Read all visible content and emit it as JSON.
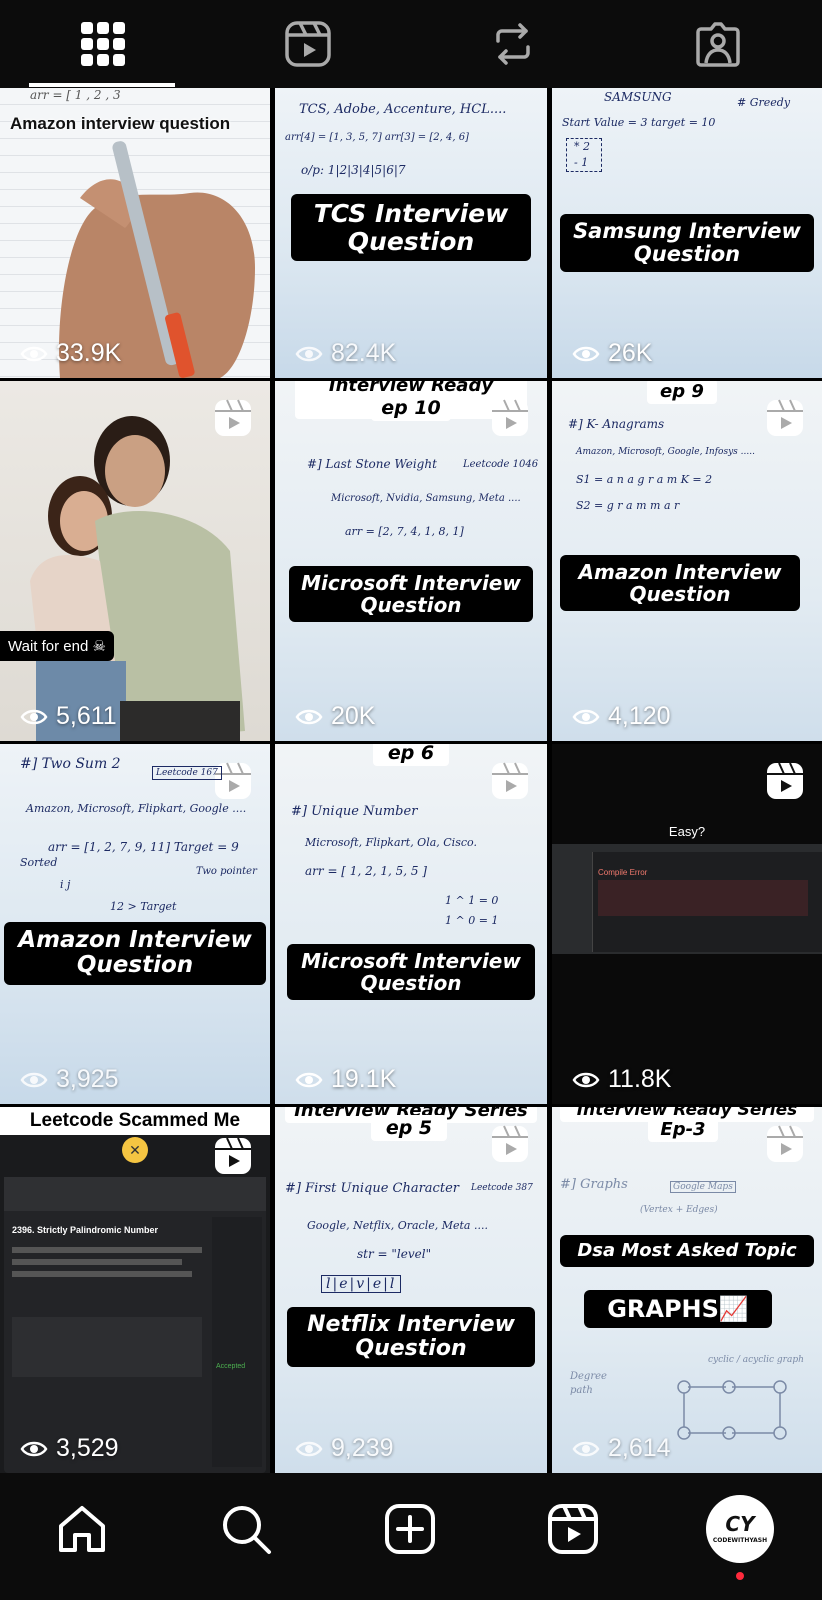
{
  "tabs": [
    {
      "name": "posts-grid",
      "icon": "grid-icon",
      "active": true
    },
    {
      "name": "reels",
      "icon": "reels-icon",
      "active": false
    },
    {
      "name": "reposts",
      "icon": "repost-icon",
      "active": false
    },
    {
      "name": "tagged",
      "icon": "tagged-person-icon",
      "active": false
    }
  ],
  "tiles": [
    {
      "title": "Amazon interview question",
      "views": "33.9K",
      "hw": [
        "arr = [ 1 , 2 , 3"
      ]
    },
    {
      "title": "TCS Interview Question",
      "views": "82.4K",
      "hw": [
        "TCS, Adobe, Accenture, HCL....",
        "arr[4] = [1, 3, 5, 7]   arr[3] = [2, 4, 6]",
        "o/p: 1|2|3|4|5|6|7"
      ]
    },
    {
      "title": "Samsung Interview Question",
      "views": "26K",
      "hw": [
        "SAMSUNG",
        "# Greedy",
        "Start Value = 3    target = 10",
        "* 2",
        "- 1"
      ]
    },
    {
      "title": "Wait for end",
      "views": "5,611",
      "hw": []
    },
    {
      "top": "Interview Ready Series",
      "top2": "ep 10",
      "title": "Microsoft Interview Question",
      "views": "20K",
      "hw": [
        "#] Last Stone Weight",
        "Leetcode 1046",
        "Microsoft, Nvidia, Samsung, Meta ....",
        "arr = [2, 7, 4, 1, 8, 1]"
      ]
    },
    {
      "top2": "ep 9",
      "title": "Amazon Interview Question",
      "views": "4,120",
      "hw": [
        "#] K- Anagrams",
        "Amazon, Microsoft, Google, Infosys .....",
        "S1 = a n a g r a m      K = 2",
        "S2 = g r a m m a r"
      ]
    },
    {
      "title": "Amazon Interview Question",
      "views": "3,925",
      "hw": [
        "#] Two Sum 2",
        "Leetcode 167",
        "Amazon, Microsoft, Flipkart, Google ....",
        "arr = [1, 2, 7, 9, 11]   Target = 9",
        "Sorted",
        "Two pointer",
        "i  j",
        "12 > Target"
      ]
    },
    {
      "top2": "ep 6",
      "title": "Microsoft Interview Question",
      "views": "19.1K",
      "hw": [
        "#] Unique Number",
        "Microsoft, Flipkart, Ola, Cisco.",
        "arr = [ 1, 2, 1, 5, 5 ]",
        "1 ^ 1 = 0",
        "1 ^ 0 = 1"
      ]
    },
    {
      "title": "Easy?",
      "views": "11.8K",
      "hw": [
        "Compile Error"
      ]
    },
    {
      "top": "Leetcode Scammed Me",
      "title": "",
      "views": "3,529",
      "hw": [
        "2396. Strictly Palindromic Number",
        "Accepted"
      ]
    },
    {
      "top": "Interview Ready Series",
      "top2": "ep 5",
      "title": "Netflix Interview Question",
      "views": "9,239",
      "hw": [
        "#] First Unique Character",
        "Leetcode 387",
        "Google, Netflix, Oracle, Meta ....",
        "str = \"level\"",
        "l|e|v|e|l"
      ]
    },
    {
      "top": "Interview Ready Series",
      "top2": "Ep-3",
      "title": "Dsa Most Asked Topic",
      "title2": "GRAPHS📈",
      "views": "2,614",
      "hw": [
        "#] Graphs",
        "Google Maps",
        "(Vertex + Edges)",
        "Degree",
        "path",
        "cyclic / acyclic graph"
      ]
    }
  ],
  "bottom_nav": [
    {
      "name": "home",
      "icon": "home-icon"
    },
    {
      "name": "search",
      "icon": "search-icon"
    },
    {
      "name": "create",
      "icon": "create-plus-icon"
    },
    {
      "name": "reels",
      "icon": "reels-icon"
    }
  ],
  "profile": {
    "mark": "CY",
    "text": "CODEWITHYASH"
  },
  "colors": {
    "bg": "#000000",
    "bar": "#0c0c0c",
    "ink": "#1c2a63",
    "dot": "#ff2a3c"
  }
}
